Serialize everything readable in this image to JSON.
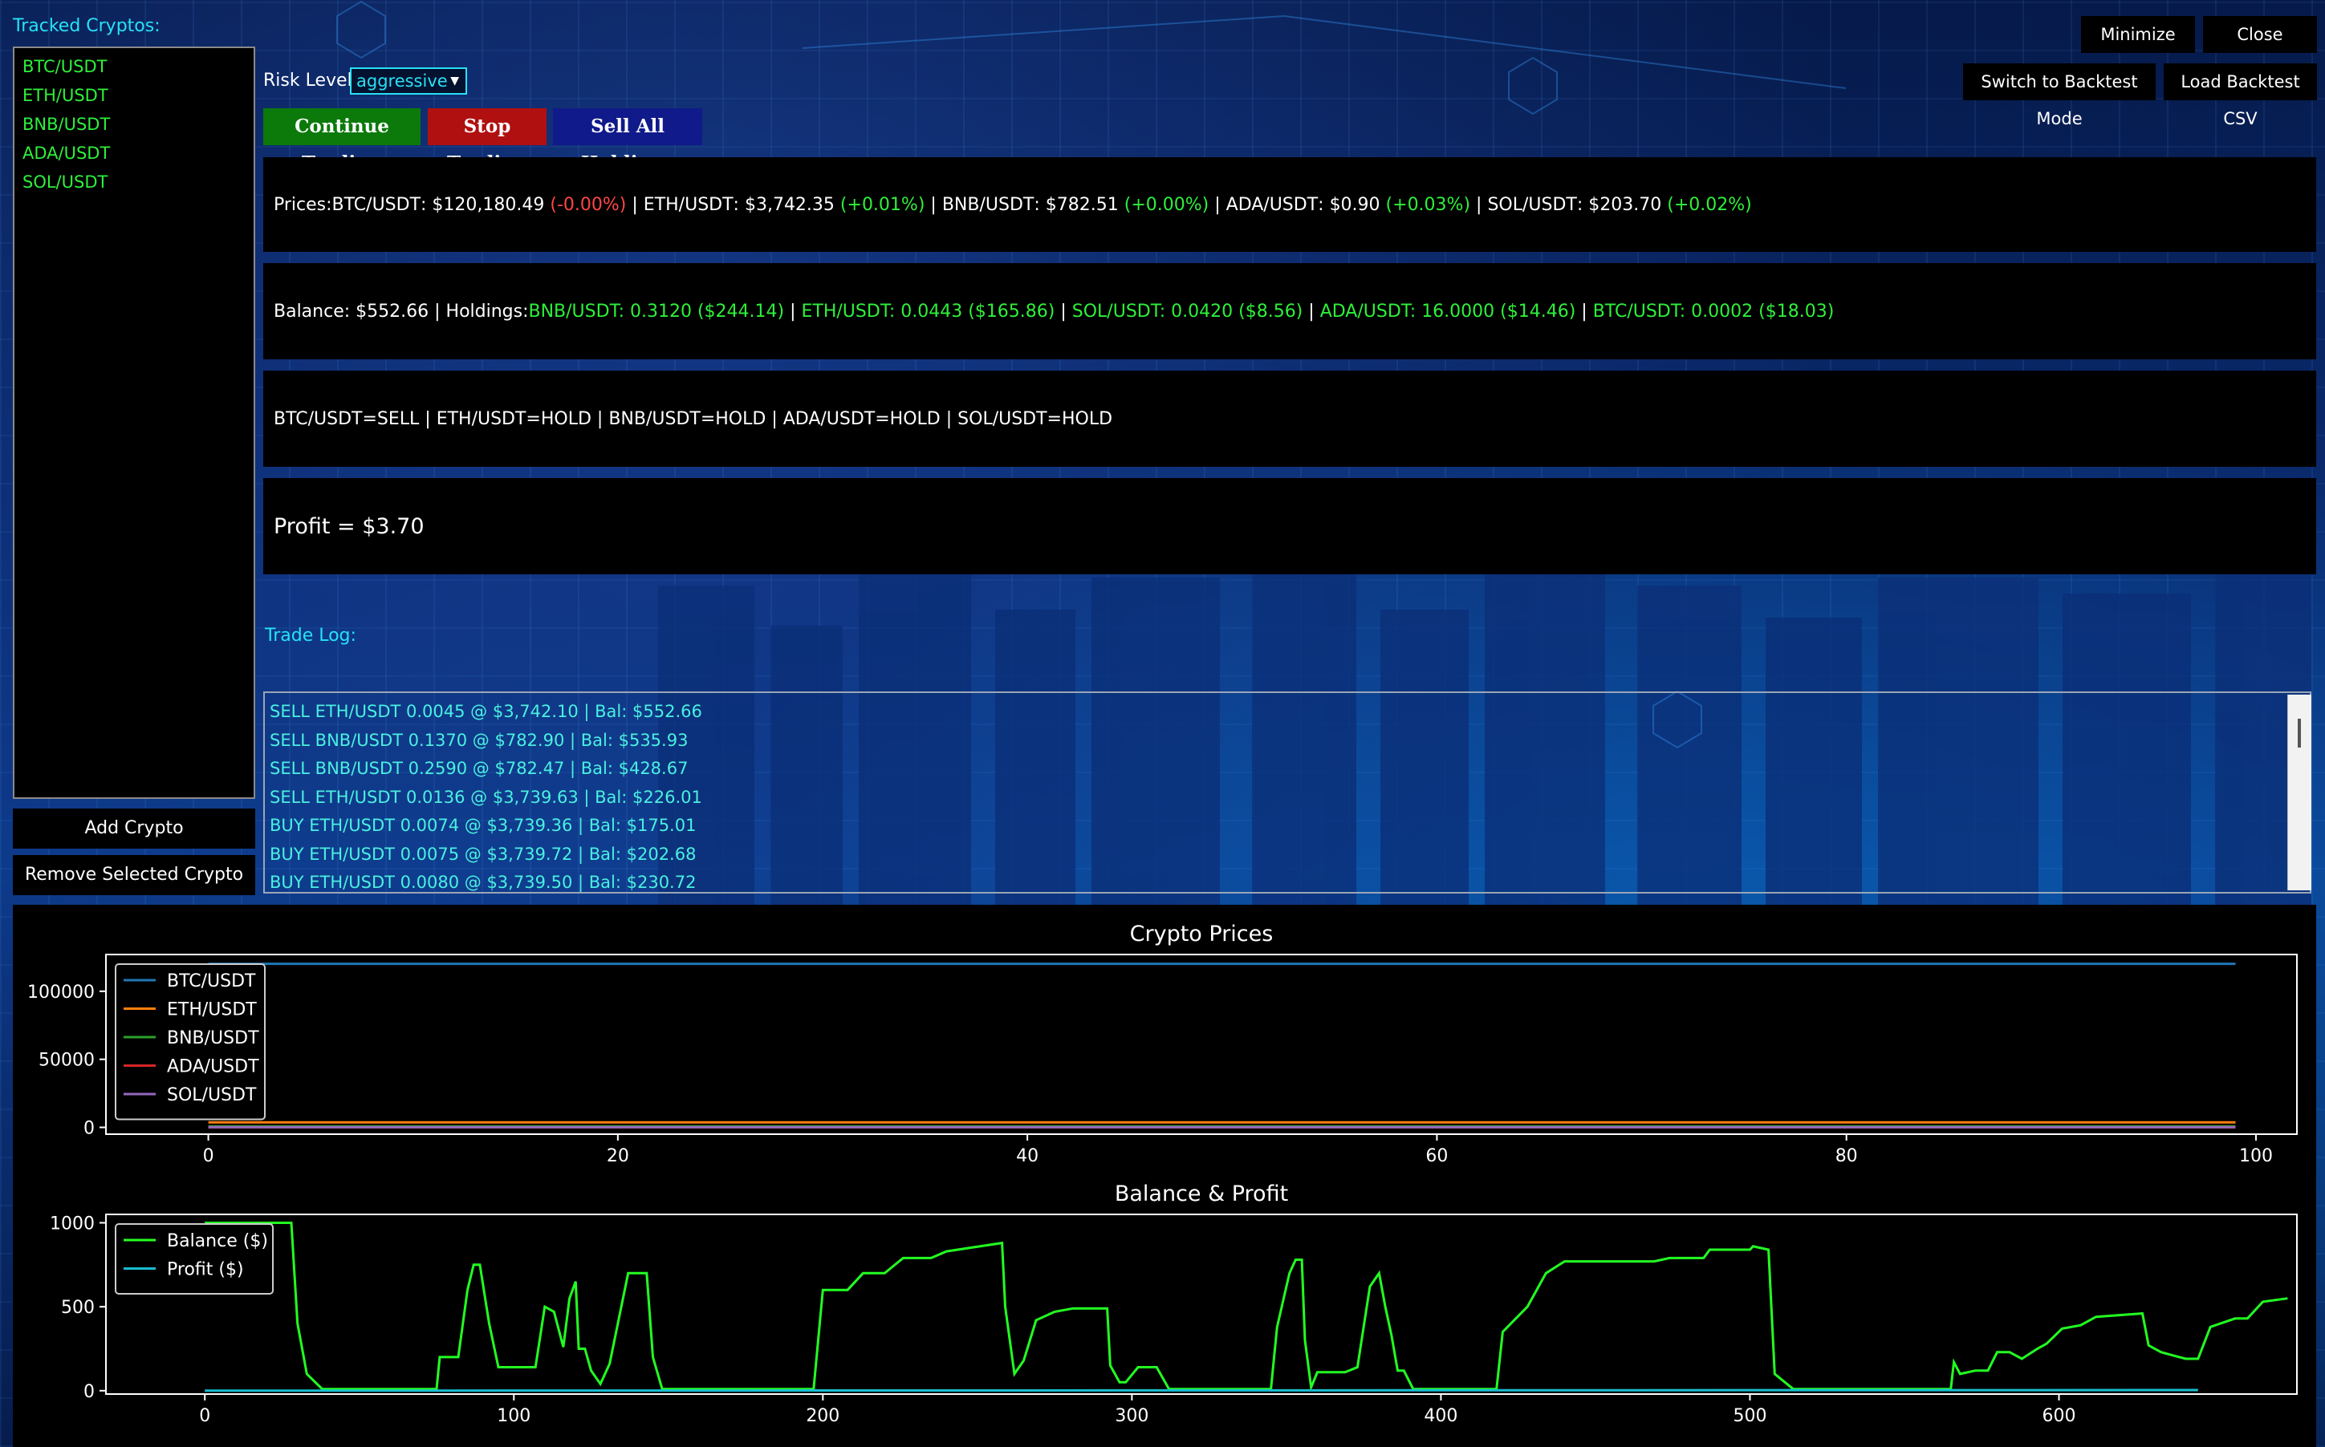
{
  "left_panel": {
    "title": "Tracked Cryptos:",
    "items": [
      "BTC/USDT",
      "ETH/USDT",
      "BNB/USDT",
      "ADA/USDT",
      "SOL/USDT"
    ],
    "add_label": "Add Crypto",
    "remove_label": "Remove Selected Crypto"
  },
  "controls": {
    "risk_label": "Risk Level:",
    "risk_value": "aggressive",
    "continue_label": "Continue Trading",
    "stop_label": "Stop Trading",
    "sell_all_label": "Sell All Holdings"
  },
  "window": {
    "minimize_label": "Minimize",
    "close_label": "Close",
    "backtest_mode_label": "Switch to Backtest Mode",
    "load_csv_label": "Load Backtest CSV"
  },
  "prices": {
    "prefix": "Prices: ",
    "items": [
      {
        "pair": "BTC/USDT",
        "price": "$120,180.49",
        "change": "(-0.00%)",
        "dir": "down"
      },
      {
        "pair": "ETH/USDT",
        "price": "$3,742.35",
        "change": "(+0.01%)",
        "dir": "up"
      },
      {
        "pair": "BNB/USDT",
        "price": "$782.51",
        "change": "(+0.00%)",
        "dir": "up"
      },
      {
        "pair": "ADA/USDT",
        "price": "$0.90",
        "change": "(+0.03%)",
        "dir": "up"
      },
      {
        "pair": "SOL/USDT",
        "price": "$203.70",
        "change": "(+0.02%)",
        "dir": "up"
      }
    ]
  },
  "balance": {
    "text": "Balance: $552.66 | Holdings: ",
    "holdings": [
      "BNB/USDT: 0.3120 ($244.14)",
      "ETH/USDT: 0.0443 ($165.86)",
      "SOL/USDT: 0.0420 ($8.56)",
      "ADA/USDT: 16.0000 ($14.46)",
      "BTC/USDT: 0.0002 ($18.03)"
    ]
  },
  "signals": [
    "BTC/USDT=SELL",
    "ETH/USDT=HOLD",
    "BNB/USDT=HOLD",
    "ADA/USDT=HOLD",
    "SOL/USDT=HOLD"
  ],
  "profit": {
    "text": "Profit = $3.70"
  },
  "trade_log": {
    "title": "Trade Log:",
    "lines": [
      "SELL ETH/USDT 0.0045 @ $3,742.10 | Bal: $552.66",
      "SELL BNB/USDT 0.1370 @ $782.90 | Bal: $535.93",
      "SELL BNB/USDT 0.2590 @ $782.47 | Bal: $428.67",
      "SELL ETH/USDT 0.0136 @ $3,739.63 | Bal: $226.01",
      "BUY ETH/USDT 0.0074 @ $3,739.36 | Bal: $175.01",
      "BUY ETH/USDT 0.0075 @ $3,739.72 | Bal: $202.68",
      "BUY ETH/USDT 0.0080 @ $3,739.50 | Bal: $230.72"
    ]
  },
  "colors": {
    "accent_cyan": "#27e1f5",
    "positive": "#2ef03a",
    "negative": "#ff4545",
    "continue": "#0b7a0b",
    "stop": "#b01010",
    "sell_all": "#101a8a"
  },
  "chart_data": [
    {
      "type": "line",
      "title": "Crypto Prices",
      "xlim": [
        -5,
        102
      ],
      "ylim": [
        -5000,
        127000
      ],
      "xticks": [
        0,
        20,
        40,
        60,
        80,
        100
      ],
      "yticks": [
        0,
        50000,
        100000
      ],
      "x": [
        0,
        99
      ],
      "legend_position": "top-left",
      "series": [
        {
          "name": "BTC/USDT",
          "color": "#1f77b4",
          "values": [
            120180,
            120180
          ]
        },
        {
          "name": "ETH/USDT",
          "color": "#ff7f0e",
          "values": [
            3742,
            3742
          ]
        },
        {
          "name": "BNB/USDT",
          "color": "#2ca02c",
          "values": [
            782,
            782
          ]
        },
        {
          "name": "ADA/USDT",
          "color": "#d62728",
          "values": [
            0.9,
            0.9
          ]
        },
        {
          "name": "SOL/USDT",
          "color": "#9467bd",
          "values": [
            204,
            204
          ]
        }
      ]
    },
    {
      "type": "line",
      "title": "Balance & Profit",
      "xlim": [
        -32,
        677
      ],
      "ylim": [
        -20,
        1050
      ],
      "xticks": [
        0,
        100,
        200,
        300,
        400,
        500,
        600
      ],
      "yticks": [
        0,
        500,
        1000
      ],
      "legend_position": "top-left",
      "series": [
        {
          "name": "Balance ($)",
          "color": "#22ff22",
          "points": [
            [
              0,
              1000
            ],
            [
              28,
              1000
            ],
            [
              30,
              400
            ],
            [
              33,
              100
            ],
            [
              38,
              10
            ],
            [
              75,
              10
            ],
            [
              76,
              200
            ],
            [
              82,
              200
            ],
            [
              85,
              600
            ],
            [
              87,
              750
            ],
            [
              89,
              750
            ],
            [
              92,
              400
            ],
            [
              95,
              140
            ],
            [
              107,
              140
            ],
            [
              110,
              500
            ],
            [
              113,
              470
            ],
            [
              116,
              260
            ],
            [
              118,
              550
            ],
            [
              120,
              650
            ],
            [
              121,
              250
            ],
            [
              123,
              250
            ],
            [
              125,
              120
            ],
            [
              128,
              40
            ],
            [
              131,
              160
            ],
            [
              137,
              700
            ],
            [
              143,
              700
            ],
            [
              145,
              200
            ],
            [
              148,
              10
            ],
            [
              197,
              10
            ],
            [
              200,
              600
            ],
            [
              208,
              600
            ],
            [
              213,
              700
            ],
            [
              220,
              700
            ],
            [
              226,
              790
            ],
            [
              235,
              790
            ],
            [
              240,
              830
            ],
            [
              258,
              880
            ],
            [
              259,
              500
            ],
            [
              262,
              100
            ],
            [
              265,
              180
            ],
            [
              269,
              420
            ],
            [
              275,
              470
            ],
            [
              281,
              490
            ],
            [
              292,
              490
            ],
            [
              293,
              150
            ],
            [
              296,
              50
            ],
            [
              298,
              50
            ],
            [
              302,
              140
            ],
            [
              308,
              140
            ],
            [
              312,
              10
            ],
            [
              345,
              10
            ],
            [
              347,
              380
            ],
            [
              351,
              700
            ],
            [
              353,
              780
            ],
            [
              355,
              780
            ],
            [
              356,
              300
            ],
            [
              358,
              20
            ],
            [
              360,
              110
            ],
            [
              363,
              110
            ],
            [
              367,
              110
            ],
            [
              369,
              110
            ],
            [
              373,
              140
            ],
            [
              377,
              620
            ],
            [
              380,
              700
            ],
            [
              382,
              500
            ],
            [
              384,
              330
            ],
            [
              386,
              120
            ],
            [
              388,
              120
            ],
            [
              391,
              10
            ],
            [
              418,
              10
            ],
            [
              420,
              350
            ],
            [
              428,
              500
            ],
            [
              434,
              700
            ],
            [
              440,
              770
            ],
            [
              469,
              770
            ],
            [
              474,
              790
            ],
            [
              485,
              790
            ],
            [
              487,
              840
            ],
            [
              500,
              840
            ],
            [
              501,
              860
            ],
            [
              506,
              840
            ],
            [
              508,
              100
            ],
            [
              514,
              10
            ],
            [
              525,
              10
            ],
            [
              565,
              10
            ],
            [
              566,
              170
            ],
            [
              568,
              100
            ],
            [
              573,
              120
            ],
            [
              577,
              120
            ],
            [
              580,
              230
            ],
            [
              584,
              230
            ],
            [
              588,
              190
            ],
            [
              593,
              250
            ],
            [
              596,
              280
            ],
            [
              601,
              370
            ],
            [
              607,
              390
            ],
            [
              612,
              440
            ],
            [
              627,
              460
            ],
            [
              629,
              270
            ],
            [
              633,
              230
            ],
            [
              637,
              210
            ],
            [
              641,
              190
            ],
            [
              645,
              190
            ],
            [
              649,
              380
            ],
            [
              657,
              430
            ],
            [
              661,
              430
            ],
            [
              666,
              530
            ],
            [
              674,
              550
            ]
          ]
        },
        {
          "name": "Profit ($)",
          "color": "#17becf",
          "points": [
            [
              0,
              0
            ],
            [
              645,
              3.7
            ]
          ]
        }
      ]
    }
  ]
}
